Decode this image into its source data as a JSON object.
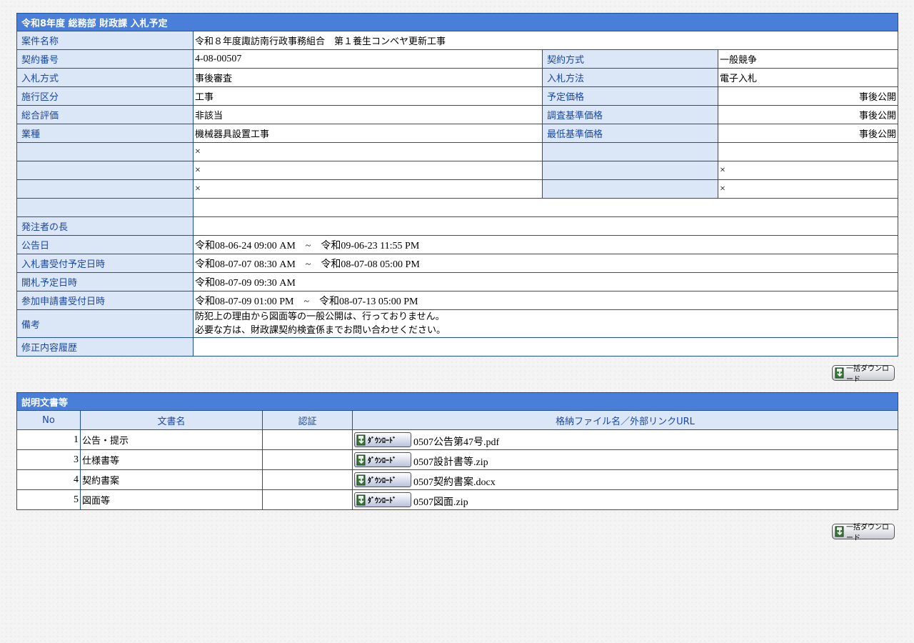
{
  "page_title": "令和8年度 総務部 財政課 入札予定",
  "fields": {
    "case_name_label": "案件名称",
    "case_name": "令和８年度諏訪南行政事務組合　第１養生コンベヤ更新工事",
    "contract_no_label": "契約番号",
    "contract_no": "4-08-00507",
    "contract_method_label": "契約方式",
    "contract_method": "一般競争",
    "bid_type_label": "入札方式",
    "bid_type": "事後審査",
    "bid_method_label": "入札方法",
    "bid_method": "電子入札",
    "category_label": "施行区分",
    "category": "工事",
    "planned_price_label": "予定価格",
    "planned_price": "事後公開",
    "evaluation_label": "総合評価",
    "evaluation": "非該当",
    "survey_price_label": "調査基準価格",
    "survey_price": "事後公開",
    "industry_label": "業種",
    "industry": "機械器具設置工事",
    "min_price_label": "最低基準価格",
    "min_price": "事後公開",
    "mark_x": "×",
    "orderer_label": "発注者の長",
    "notice_date_label": "公告日",
    "notice_date": "令和08-06-24 09:00 AM　~　令和09-06-23 11:55 PM",
    "bid_receipt_label": "入札書受付予定日時",
    "bid_receipt": "令和08-07-07 08:30 AM　~　令和08-07-08 05:00 PM",
    "opening_label": "開札予定日時",
    "opening": "令和08-07-09 09:30 AM",
    "application_label": "参加申請書受付日時",
    "application": "令和08-07-09 01:00 PM　~　令和08-07-13 05:00 PM",
    "remarks_label": "備考",
    "remarks_line1": "防犯上の理由から図面等の一般公開は、行っておりません。",
    "remarks_line2": "必要な方は、財政課契約検査係までお問い合わせください。",
    "history_label": "修正内容履歴"
  },
  "bulk_download_label": "一括ダウンロード",
  "download_label": "ﾀﾞｳﾝﾛｰﾄﾞ",
  "docs": {
    "title": "説明文書等",
    "headers": [
      "No",
      "文書名",
      "認証",
      "格納ファイル名／外部リンクURL"
    ],
    "rows": [
      {
        "no": "1",
        "name": "公告・提示",
        "auth": "",
        "file": "0507公告第47号.pdf"
      },
      {
        "no": "3",
        "name": "仕様書等",
        "auth": "",
        "file": "0507設計書等.zip"
      },
      {
        "no": "4",
        "name": "契約書案",
        "auth": "",
        "file": "0507契約書案.docx"
      },
      {
        "no": "5",
        "name": "図面等",
        "auth": "",
        "file": "0507図面.zip"
      }
    ]
  },
  "colors": {
    "caption_bg": "#4a7fd9",
    "label_bg": "#dbe7f7",
    "label_text": "#1a47a6",
    "border": "#1f4f9f"
  }
}
